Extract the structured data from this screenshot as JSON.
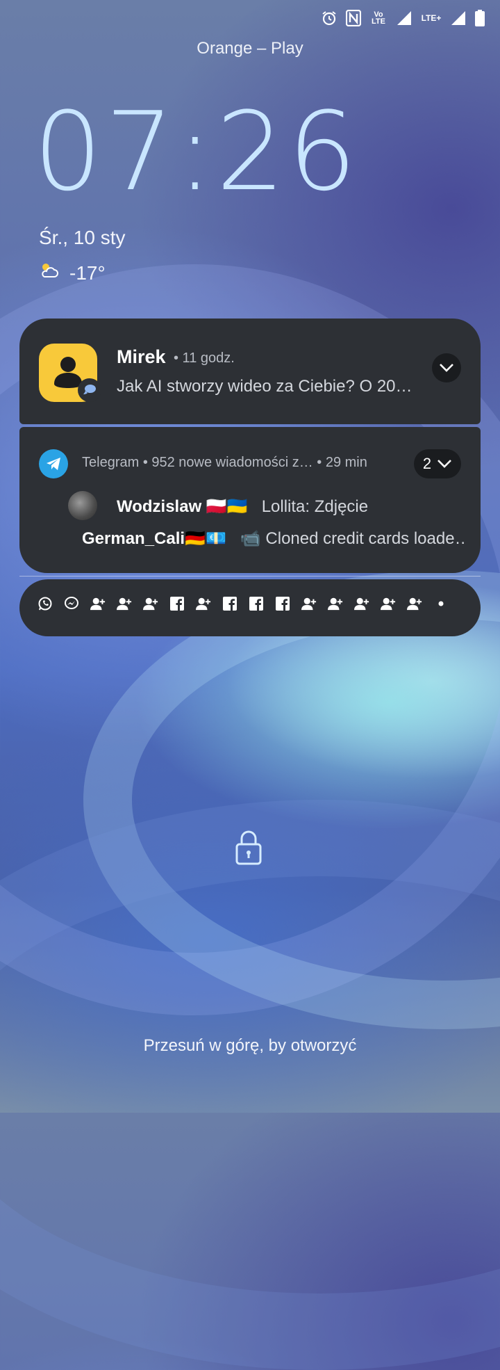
{
  "status_bar": {
    "icons": [
      "alarm-icon",
      "nfc-icon",
      "volte-icon",
      "signal-icon",
      "lte-plus-icon",
      "signal-icon",
      "battery-icon"
    ],
    "volte_label": "Vo LTE",
    "lte_label": "LTE+"
  },
  "carrier": "Orange – Play",
  "clock": "07:26",
  "date": "Śr., 10 sty",
  "weather": {
    "icon": "partly-cloudy-icon",
    "temperature": "-17°"
  },
  "notifications": [
    {
      "app_icon": "contact-icon",
      "badge_icon": "message-icon",
      "title": "Mirek",
      "meta": "• 11 godz.",
      "body": "Jak AI stworzy wideo za Ciebie? O 20…"
    },
    {
      "app": "Telegram",
      "header": "Telegram • 952 nowe wiadomości z… • 29 min",
      "count": "2",
      "line1_sender": "Wodzislaw 🇵🇱🇺🇦",
      "line1_text": "Lollita: Zdjęcie",
      "line2_sender": "German_Cali🇩🇪💶",
      "line2_text": "📹 Cloned credit cards loade…"
    }
  ],
  "collapsed_notifications": {
    "icons": [
      "whatsapp-icon",
      "messenger-icon",
      "add-contact-icon",
      "add-contact-icon",
      "add-contact-icon",
      "facebook-icon",
      "add-contact-icon",
      "facebook-icon",
      "facebook-icon",
      "facebook-icon",
      "add-contact-icon",
      "add-contact-icon",
      "add-contact-icon",
      "add-contact-icon",
      "add-contact-icon",
      "more-dot-icon"
    ]
  },
  "lock_icon": "lock-icon",
  "swipe_hint": "Przesuń w górę, by otworzyć",
  "colors": {
    "clock": "#c9e6ff",
    "card": "#2d3035",
    "telegram": "#2aa3e5",
    "app_icon": "#f8c93a"
  }
}
